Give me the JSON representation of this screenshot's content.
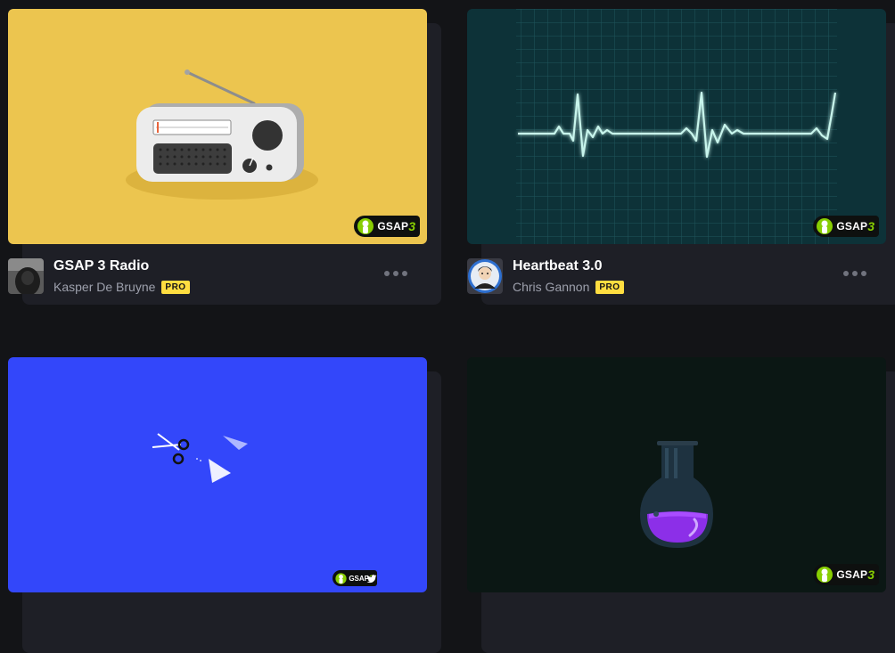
{
  "cards": [
    {
      "title": "GSAP 3 Radio",
      "author": "Kasper De Bruyne",
      "badge": "PRO",
      "thumb_color": "#ecc54f",
      "avatar_icon": "dark-hooded-figure-avatar"
    },
    {
      "title": "Heartbeat 3.0",
      "author": "Chris Gannon",
      "badge": "PRO",
      "thumb_color": "#0d3238",
      "avatar_icon": "cartoon-man-avatar"
    },
    {
      "title": "",
      "author": "",
      "badge": "",
      "thumb_color": "#3347fa"
    },
    {
      "title": "",
      "author": "",
      "badge": "",
      "thumb_color": "#0b1714"
    }
  ],
  "gsap_badge": {
    "text": "GSAP",
    "version": "3"
  },
  "colors": {
    "page_bg": "#131417",
    "card_bg": "#1e1f26",
    "pro_badge": "#ffdd40",
    "gsap_green": "#88ce02"
  }
}
